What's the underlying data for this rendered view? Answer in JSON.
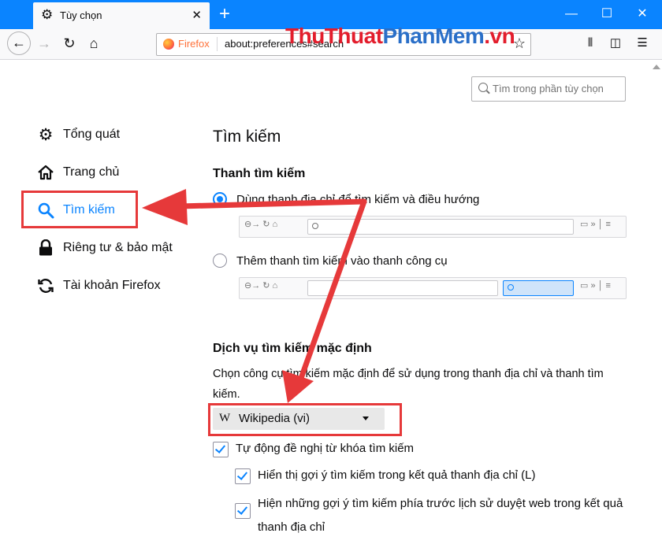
{
  "tab": {
    "title": "Tùy chọn"
  },
  "urlbar": {
    "identity": "Firefox",
    "url": "about:preferences#search"
  },
  "watermark": {
    "part1": "ThuThuat",
    "part2": "PhanMem",
    "part3": ".vn"
  },
  "search_prefs": {
    "placeholder": "Tìm trong phần tùy chọn"
  },
  "categories": [
    {
      "label": "Tổng quát",
      "icon": "gear-icon"
    },
    {
      "label": "Trang chủ",
      "icon": "home-icon"
    },
    {
      "label": "Tìm kiếm",
      "icon": "search-icon",
      "selected": true
    },
    {
      "label": "Riêng tư & bảo mật",
      "icon": "lock-icon"
    },
    {
      "label": "Tài khoản Firefox",
      "icon": "sync-icon"
    }
  ],
  "main": {
    "title": "Tìm kiếm",
    "searchbar_heading": "Thanh tìm kiếm",
    "option_urlbar": "Dùng thanh địa chỉ để tìm kiếm và điều hướng",
    "option_searchbar": "Thêm thanh tìm kiếm vào thanh công cụ",
    "default_heading": "Dịch vụ tìm kiếm mặc định",
    "default_desc": "Chọn công cụ tìm kiếm mặc định để sử dụng trong thanh địa chỉ và thanh tìm kiếm.",
    "engine": "Wikipedia (vi)",
    "engine_icon_glyph": "W",
    "suggest": "Tự động đề nghị từ khóa tìm kiếm",
    "suggest_urlbar": "Hiển thị gợi ý tìm kiếm trong kết quả thanh địa chỉ (L)",
    "suggest_history": "Hiện những gợi ý tìm kiếm phía trước lịch sử duyệt web trong kết quả thanh địa chỉ"
  },
  "colors": {
    "accent": "#0a84ff",
    "annotation": "#e6393a",
    "titlebar": "#0a84ff"
  }
}
